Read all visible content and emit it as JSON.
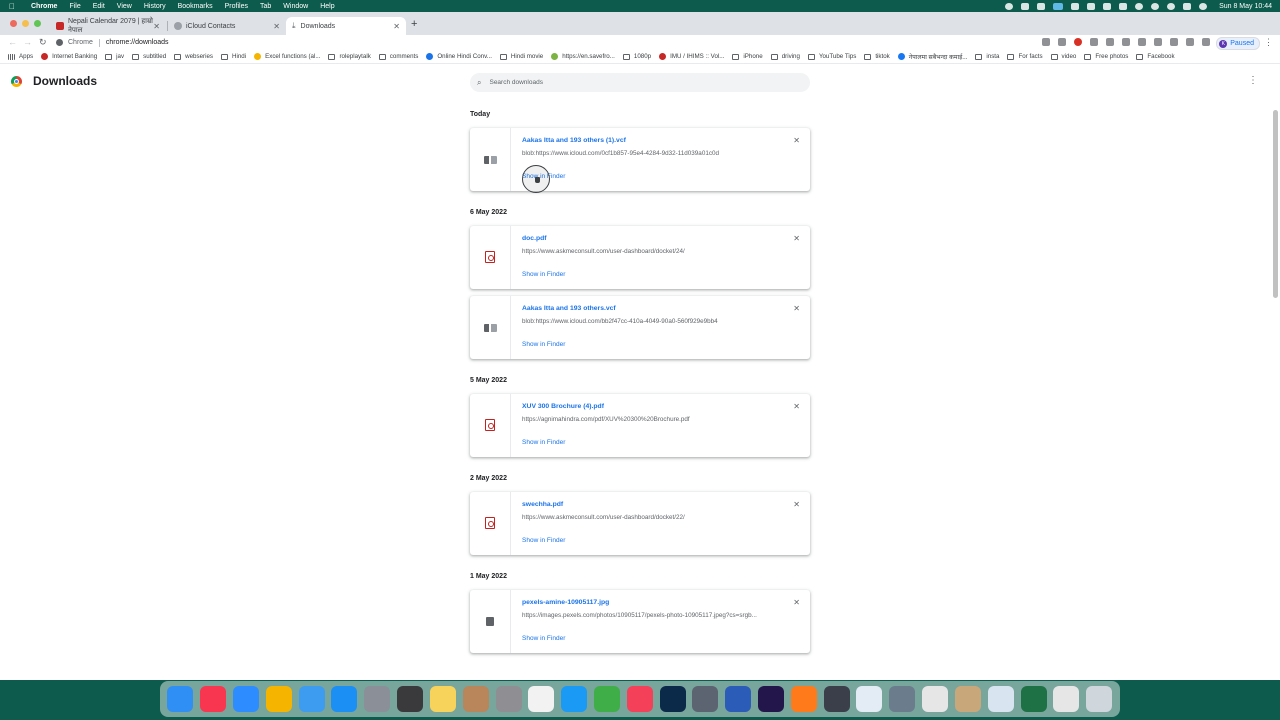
{
  "menubar": {
    "items": [
      "Chrome",
      "File",
      "Edit",
      "View",
      "History",
      "Bookmarks",
      "Profiles",
      "Tab",
      "Window",
      "Help"
    ],
    "clock": "Sun 8 May  10:44"
  },
  "tabs": [
    {
      "title": "Nepali Calendar 2079 | हाम्रो नेपाल",
      "favicon_color": "#c62828"
    },
    {
      "title": "iCloud Contacts",
      "favicon_color": "#9aa0a6"
    },
    {
      "title": "Downloads",
      "favicon_color": "#5f6368",
      "active": true
    }
  ],
  "omnibox": {
    "scheme": "Chrome",
    "url": "chrome://downloads"
  },
  "profile": {
    "initial": "K",
    "label": "Paused"
  },
  "bookmarks": [
    {
      "label": "Apps",
      "icon": "grid"
    },
    {
      "label": "Internet Banking",
      "icon": "dot",
      "color": "#c62828"
    },
    {
      "label": "jav",
      "icon": "folder"
    },
    {
      "label": "subtitled",
      "icon": "folder"
    },
    {
      "label": "webseries",
      "icon": "folder"
    },
    {
      "label": "Hindi",
      "icon": "folder"
    },
    {
      "label": "Excel functions (al...",
      "icon": "dot",
      "color": "#f4b400"
    },
    {
      "label": "roleplaytalk",
      "icon": "folder"
    },
    {
      "label": "comments",
      "icon": "folder"
    },
    {
      "label": "Online Hindi Conv...",
      "icon": "dot",
      "color": "#1a73e8"
    },
    {
      "label": "Hindi movie",
      "icon": "folder"
    },
    {
      "label": "https://en.savefro...",
      "icon": "dot",
      "color": "#7cb342"
    },
    {
      "label": "1080p",
      "icon": "folder"
    },
    {
      "label": "IMU / IHIMS :: Vol...",
      "icon": "dot",
      "color": "#c62828"
    },
    {
      "label": "iPhone",
      "icon": "folder"
    },
    {
      "label": "driving",
      "icon": "folder"
    },
    {
      "label": "YouTube Tips",
      "icon": "folder"
    },
    {
      "label": "tiktok",
      "icon": "folder"
    },
    {
      "label": "नेपालमा सबैभन्दा कमाई...",
      "icon": "dot",
      "color": "#1877f2"
    },
    {
      "label": "insta",
      "icon": "folder"
    },
    {
      "label": "For facts",
      "icon": "folder"
    },
    {
      "label": "video",
      "icon": "folder"
    },
    {
      "label": "Free photos",
      "icon": "folder"
    },
    {
      "label": "Facebook",
      "icon": "folder"
    }
  ],
  "page": {
    "title": "Downloads",
    "search_placeholder": "Search downloads"
  },
  "groups": [
    {
      "date": "Today",
      "items": [
        {
          "name": "Aakas Itta and 193 others (1).vcf",
          "url": "blob:https://www.icloud.com/0cf1b857-95e4-4284-9d32-11d039a01c0d",
          "action": "Show in Finder",
          "type": "vcf"
        }
      ]
    },
    {
      "date": "6 May 2022",
      "items": [
        {
          "name": "doc.pdf",
          "url": "https://www.askmeconsult.com/user-dashboard/docket/24/",
          "action": "Show in Finder",
          "type": "pdf"
        },
        {
          "name": "Aakas Itta and 193 others.vcf",
          "url": "blob:https://www.icloud.com/bb2f47cc-410a-4049-90a0-560f929e9bb4",
          "action": "Show in Finder",
          "type": "vcf"
        }
      ]
    },
    {
      "date": "5 May 2022",
      "items": [
        {
          "name": "XUV 300 Brochure (4).pdf",
          "url": "https://agnimahindra.com/pdf/XUV%20300%20Brochure.pdf",
          "action": "Show in Finder",
          "type": "pdf"
        }
      ]
    },
    {
      "date": "2 May 2022",
      "items": [
        {
          "name": "swechha.pdf",
          "url": "https://www.askmeconsult.com/user-dashboard/docket/22/",
          "action": "Show in Finder",
          "type": "pdf"
        }
      ]
    },
    {
      "date": "1 May 2022",
      "items": [
        {
          "name": "pexels-amine-10905117.jpg",
          "url": "https://images.pexels.com/photos/10905117/pexels-photo-10905117.jpeg?cs=srgb...",
          "action": "Show in Finder",
          "type": "img"
        }
      ]
    }
  ],
  "dock": [
    {
      "name": "finder-icon",
      "color": "#2f8ff5"
    },
    {
      "name": "music-icon",
      "color": "#f8364f"
    },
    {
      "name": "zoom-icon",
      "color": "#2d8cff"
    },
    {
      "name": "photos-icon",
      "color": "#f4b400"
    },
    {
      "name": "mail-icon",
      "color": "#3d9cf0"
    },
    {
      "name": "app-store-icon",
      "color": "#1c8ff5"
    },
    {
      "name": "launchpad-icon",
      "color": "#8a8f98"
    },
    {
      "name": "calculator-icon",
      "color": "#3a3a3c"
    },
    {
      "name": "notes-icon",
      "color": "#f7d35c"
    },
    {
      "name": "box-icon",
      "color": "#b8865a"
    },
    {
      "name": "system-preferences-icon",
      "color": "#8e8e93"
    },
    {
      "name": "calendar-icon",
      "color": "#f2f2f2"
    },
    {
      "name": "safari-icon",
      "color": "#1a9af5"
    },
    {
      "name": "torrent-icon",
      "color": "#3fae49"
    },
    {
      "name": "news-icon",
      "color": "#f5405a"
    },
    {
      "name": "photoshop-icon",
      "color": "#0b2a4a"
    },
    {
      "name": "vm-icon",
      "color": "#5b6470"
    },
    {
      "name": "word-icon",
      "color": "#2b5cb8"
    },
    {
      "name": "premiere-icon",
      "color": "#23164a"
    },
    {
      "name": "firefox-icon",
      "color": "#ff7a1a"
    },
    {
      "name": "quicktime-icon",
      "color": "#3a3f4a"
    },
    {
      "name": "chrome-icon",
      "color": "#e3ebf5"
    },
    {
      "name": "preview-icon",
      "color": "#6b7c8c"
    },
    {
      "name": "textedit-icon",
      "color": "#e6e6e6"
    },
    {
      "name": "contacts-icon",
      "color": "#c8a77a"
    },
    {
      "name": "help-icon",
      "color": "#d8e4f0"
    },
    {
      "name": "excel-icon",
      "color": "#1e7145"
    },
    {
      "name": "window-icon",
      "color": "#e6e6e6"
    },
    {
      "name": "trash-icon",
      "color": "#cfd6dc"
    }
  ]
}
